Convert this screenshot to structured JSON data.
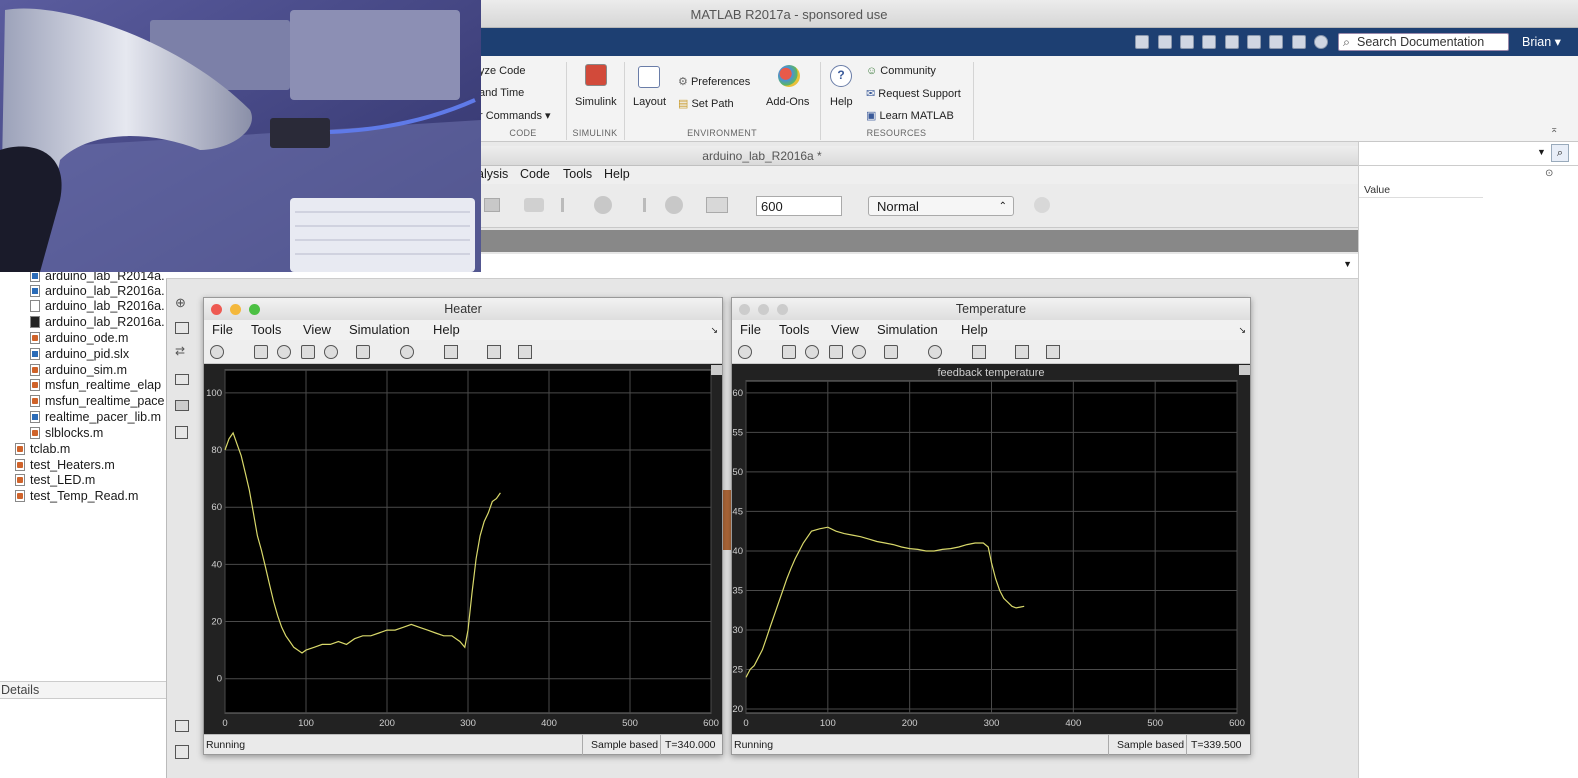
{
  "app": {
    "title": "MATLAB R2017a - sponsored use",
    "search_placeholder": "Search Documentation",
    "user": "Brian",
    "user_caret": "▾"
  },
  "ribbon": {
    "code_items": [
      "yze Code",
      "and Time",
      "r Commands"
    ],
    "code_caret": "▾",
    "simulink_label": "Simulink",
    "layout_label": "Layout",
    "preferences_label": "Preferences",
    "set_path_label": "Set Path",
    "addons_label": "Add-Ons",
    "help_label": "Help",
    "community_label": "Community",
    "request_support_label": "Request Support",
    "learn_matlab_label": "Learn MATLAB",
    "groups": [
      "CODE",
      "SIMULINK",
      "ENVIRONMENT",
      "RESOURCES"
    ]
  },
  "files": [
    {
      "name": "arduino_lab_R2014a.",
      "type": "slx"
    },
    {
      "name": "arduino_lab_R2016a.",
      "type": "slx"
    },
    {
      "name": "arduino_lab_R2016a.",
      "type": "plain"
    },
    {
      "name": "arduino_lab_R2016a.",
      "type": "black"
    },
    {
      "name": "arduino_ode.m",
      "type": "m"
    },
    {
      "name": "arduino_pid.slx",
      "type": "slx"
    },
    {
      "name": "arduino_sim.m",
      "type": "m"
    },
    {
      "name": "msfun_realtime_elap",
      "type": "m"
    },
    {
      "name": "msfun_realtime_pace",
      "type": "m"
    },
    {
      "name": "realtime_pacer_lib.m",
      "type": "slx"
    },
    {
      "name": "slblocks.m",
      "type": "m"
    },
    {
      "name": "tclab.m",
      "type": "m"
    },
    {
      "name": "test_Heaters.m",
      "type": "m"
    },
    {
      "name": "test_LED.m",
      "type": "m"
    },
    {
      "name": "test_Temp_Read.m",
      "type": "m"
    }
  ],
  "details_label": "Details",
  "simulink": {
    "title": "arduino_lab_R2016a *",
    "menus": [
      "alysis",
      "Code",
      "Tools",
      "Help"
    ],
    "stop_time": "600",
    "mode": "Normal",
    "mode_caret": "⌃"
  },
  "workspace": {
    "value_header": "Value"
  },
  "scope_menu": [
    "File",
    "Tools",
    "View",
    "Simulation",
    "Help"
  ],
  "heater_scope": {
    "title": "Heater",
    "status": "Running",
    "sample": "Sample based",
    "time": "T=340.000"
  },
  "temp_scope": {
    "title": "Temperature",
    "status": "Running",
    "sample": "Sample based",
    "time": "T=339.500"
  },
  "colors": {
    "trace": "#d8d86a",
    "plot_bg": "#000000",
    "grid": "#4a4a4a",
    "axis_text": "#cfcfcf"
  },
  "chart_data": [
    {
      "type": "line",
      "title": "",
      "xlim": [
        0,
        600
      ],
      "ylim": [
        -12,
        108
      ],
      "xticks": [
        0,
        100,
        200,
        300,
        400,
        500,
        600
      ],
      "yticks": [
        0,
        20,
        40,
        60,
        80,
        100
      ],
      "x": [
        0,
        5,
        10,
        15,
        20,
        25,
        30,
        35,
        40,
        45,
        50,
        55,
        60,
        65,
        70,
        75,
        80,
        85,
        90,
        95,
        100,
        110,
        120,
        130,
        140,
        150,
        160,
        170,
        180,
        190,
        200,
        210,
        220,
        230,
        240,
        250,
        260,
        270,
        280,
        290,
        296,
        300,
        305,
        310,
        315,
        320,
        325,
        330,
        335,
        340
      ],
      "y": [
        80,
        84,
        86,
        82,
        78,
        72,
        66,
        58,
        50,
        45,
        39,
        33,
        27,
        22,
        18,
        15,
        13,
        11,
        10,
        9,
        10,
        11,
        12,
        12,
        13,
        12,
        14,
        15,
        15,
        16,
        17,
        17,
        18,
        19,
        18,
        17,
        16,
        15,
        15,
        13,
        11,
        17,
        30,
        42,
        50,
        55,
        58,
        62,
        63,
        65
      ]
    },
    {
      "type": "line",
      "title": "feedback temperature",
      "xlim": [
        0,
        600
      ],
      "ylim": [
        19.5,
        61.5
      ],
      "xticks": [
        0,
        100,
        200,
        300,
        400,
        500,
        600
      ],
      "yticks": [
        20,
        25,
        30,
        35,
        40,
        45,
        50,
        55,
        60
      ],
      "x": [
        0,
        5,
        10,
        15,
        20,
        25,
        30,
        35,
        40,
        45,
        50,
        55,
        60,
        65,
        70,
        80,
        90,
        100,
        110,
        120,
        130,
        140,
        150,
        160,
        170,
        180,
        190,
        200,
        210,
        220,
        230,
        240,
        250,
        260,
        270,
        280,
        290,
        296,
        300,
        305,
        310,
        315,
        320,
        325,
        330,
        335,
        340
      ],
      "y": [
        24,
        25,
        25.5,
        26.5,
        27.5,
        29,
        30.5,
        32,
        33.5,
        35,
        36.5,
        37.8,
        39,
        40,
        41,
        42.5,
        42.8,
        43,
        42.5,
        42.2,
        42,
        41.8,
        41.5,
        41.2,
        41,
        40.8,
        40.5,
        40.3,
        40.2,
        40,
        40,
        40.2,
        40.3,
        40.5,
        40.8,
        41,
        41,
        40.5,
        38.5,
        36.5,
        35,
        34,
        33.5,
        33,
        32.8,
        32.9,
        33
      ]
    }
  ]
}
